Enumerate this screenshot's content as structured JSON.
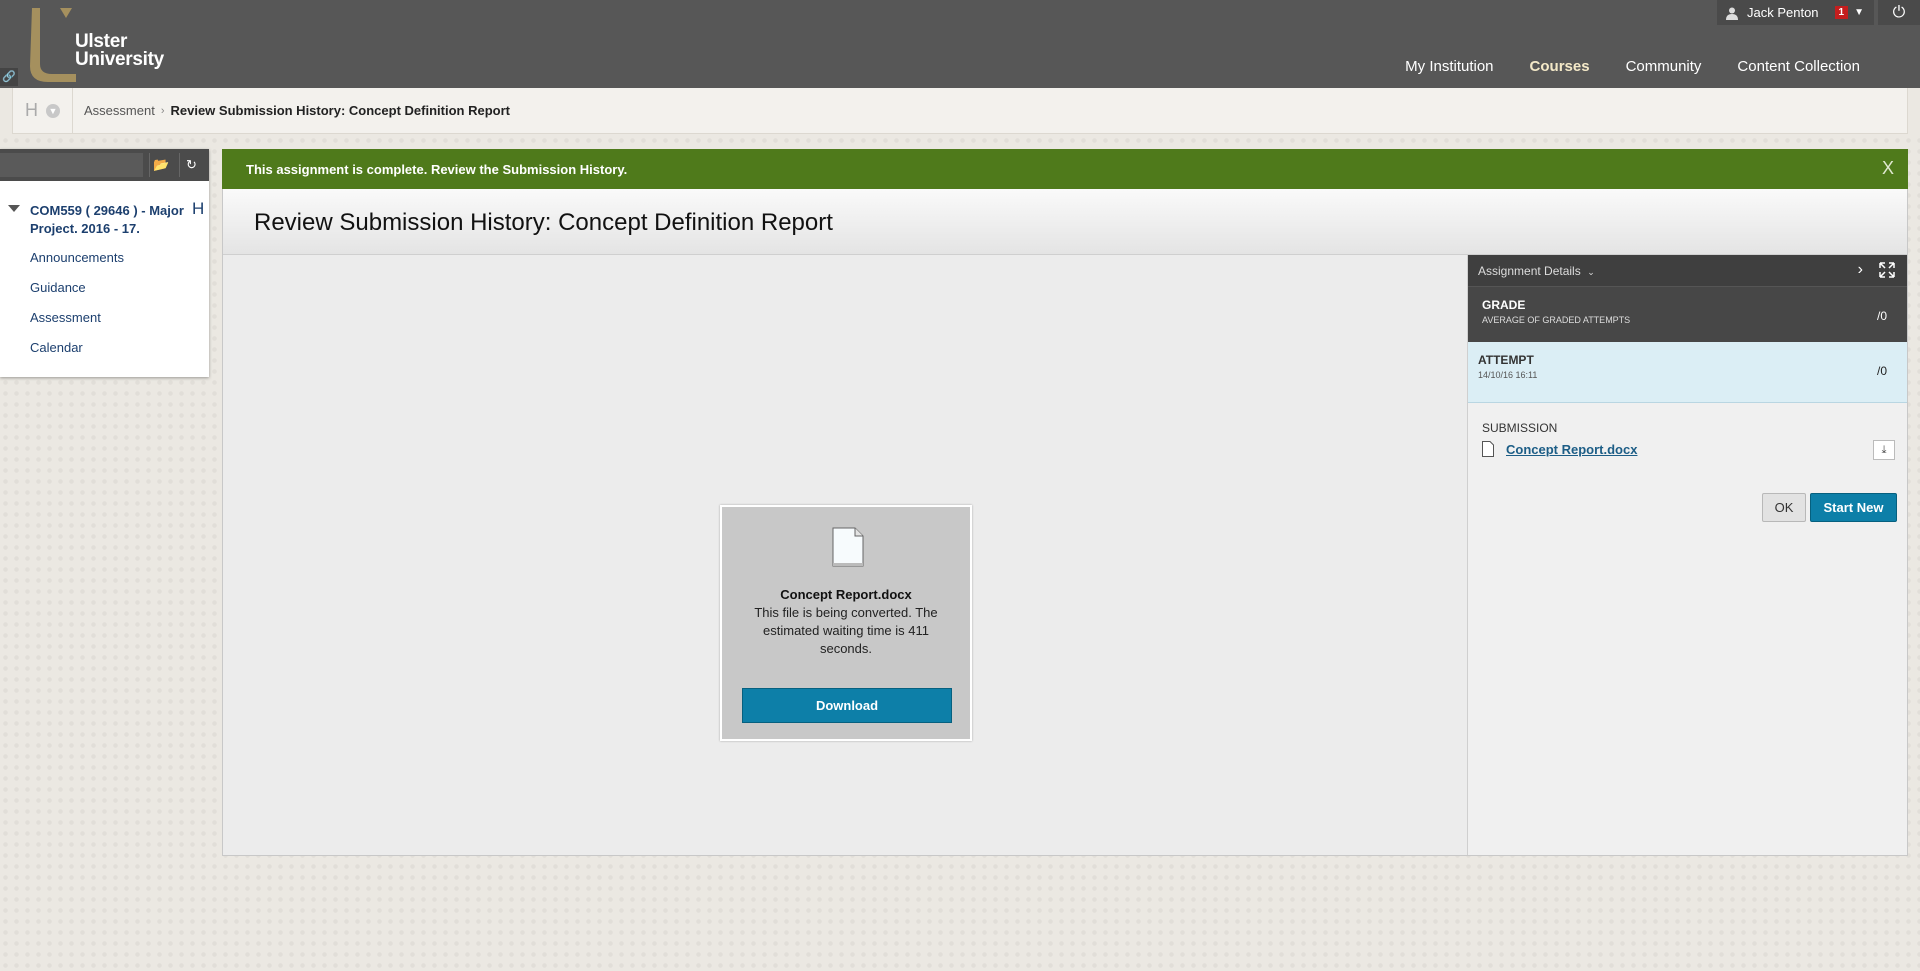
{
  "brand": {
    "line1": "Ulster",
    "line2": "University",
    "gold": "#a5905e"
  },
  "user": {
    "name": "Jack Penton",
    "notifications": "1"
  },
  "topnav": [
    "My Institution",
    "Courses",
    "Community",
    "Content Collection"
  ],
  "topnav_active": "Courses",
  "breadcrumb": {
    "menu_letter": "H",
    "parent": "Assessment",
    "separator": "›",
    "current": "Review Submission History: Concept Definition Report"
  },
  "leftmenu": {
    "course_title": "COM559 ( 29646 ) - Major Project. 2016 - 17.",
    "course_marker": "H",
    "items": [
      "Announcements",
      "Guidance",
      "Assessment",
      "Calendar"
    ]
  },
  "alert": {
    "text": "This assignment is complete. Review the Submission History.",
    "close": "X",
    "color": "#4f7a1b"
  },
  "page_title": "Review Submission History: Concept Definition Report",
  "viewer": {
    "file_name": "Concept Report.docx",
    "message": "This file is being converted. The estimated waiting time is 411 seconds.",
    "download_label": "Download"
  },
  "panel": {
    "header": "Assignment Details",
    "grade_label": "GRADE",
    "grade_sub": "AVERAGE OF GRADED ATTEMPTS",
    "grade_value": "/0",
    "attempt_label": "ATTEMPT",
    "attempt_date": "14/10/16 16:11",
    "attempt_value": "/0",
    "submission_label": "SUBMISSION",
    "submission_file": "Concept Report.docx",
    "ok_label": "OK",
    "start_new_label": "Start New",
    "accent": "#0d7fa8"
  }
}
